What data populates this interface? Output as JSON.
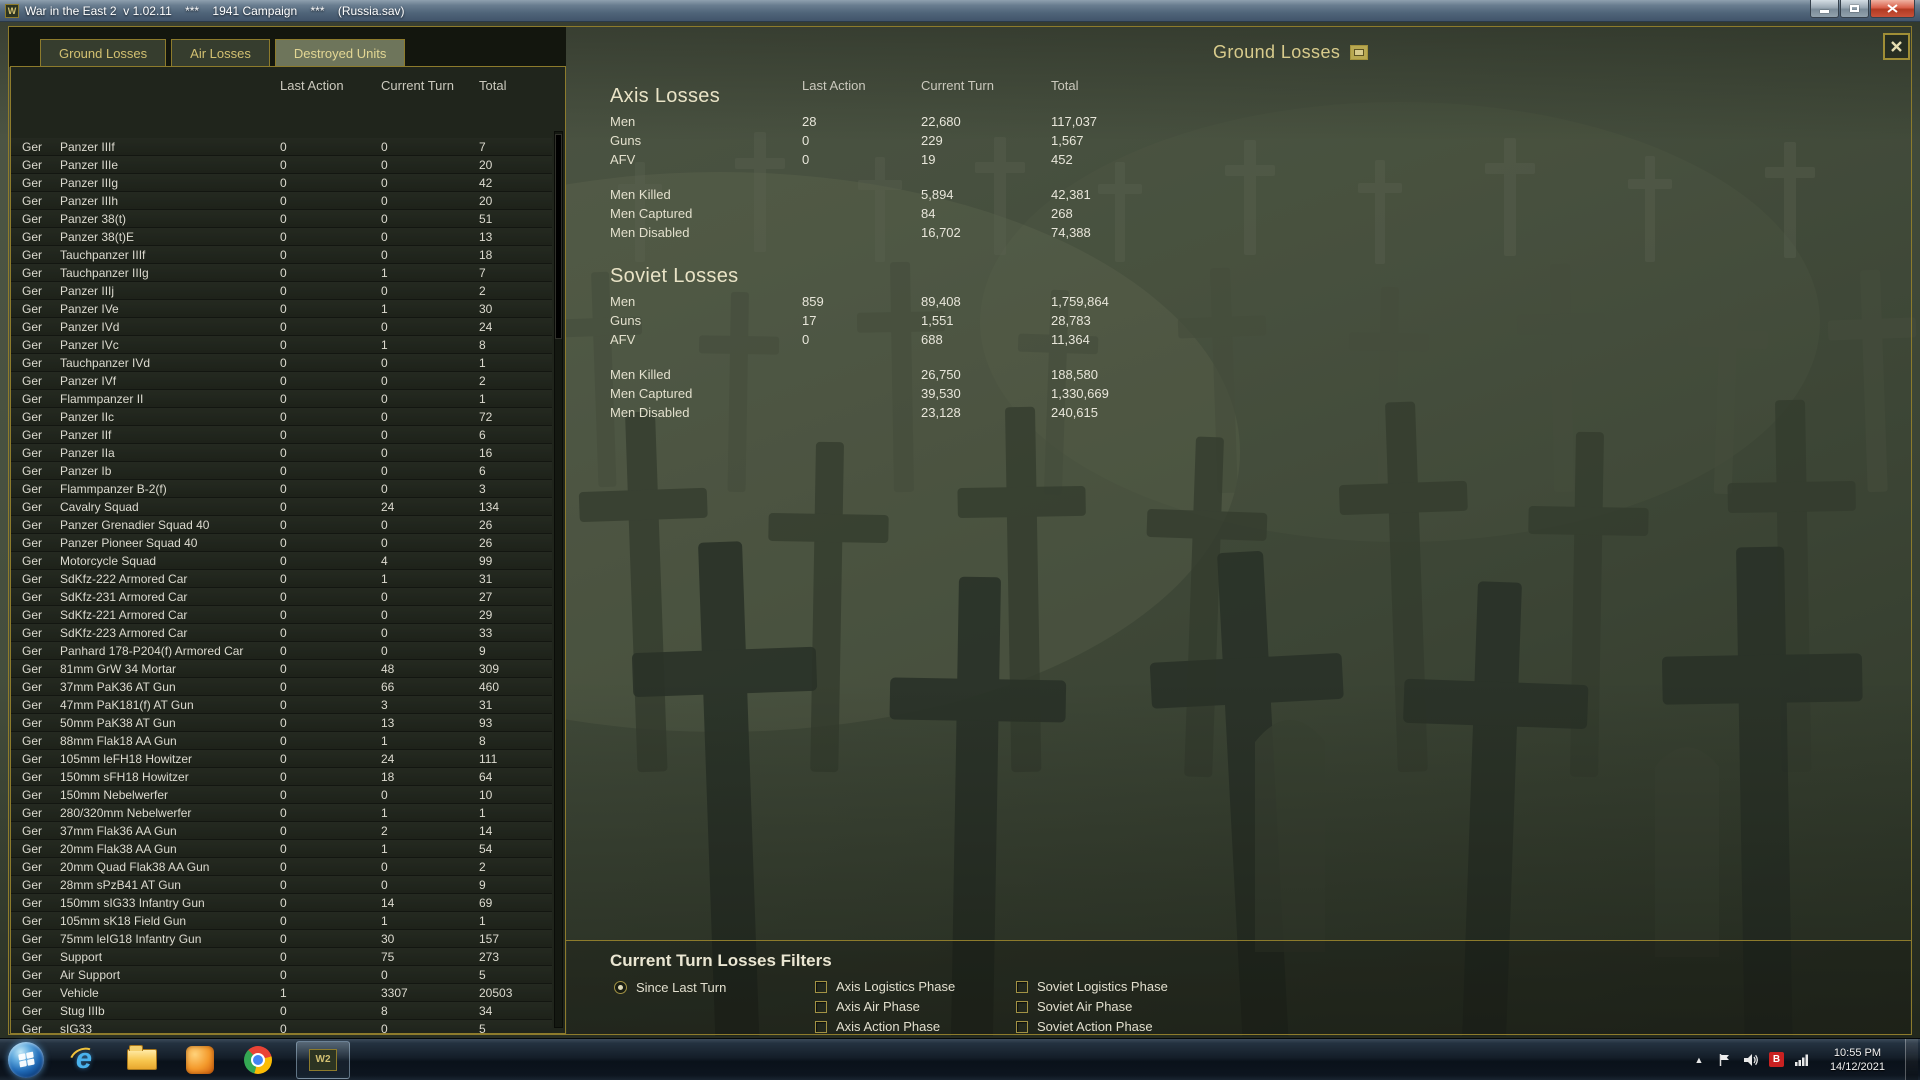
{
  "window": {
    "title": "War in the East 2  v 1.02.11    ***    1941 Campaign    ***    (Russia.sav)",
    "app_badge": "W"
  },
  "page_title": "Ground Losses",
  "tabs": [
    {
      "label": "Ground Losses",
      "active": false
    },
    {
      "label": "Air Losses",
      "active": false
    },
    {
      "label": "Destroyed Units",
      "active": true
    }
  ],
  "left_table": {
    "columns": [
      "Last Action",
      "Current Turn",
      "Total"
    ],
    "rows": [
      [
        "Ger",
        "Panzer IIIf",
        "0",
        "0",
        "7"
      ],
      [
        "Ger",
        "Panzer IIIe",
        "0",
        "0",
        "20"
      ],
      [
        "Ger",
        "Panzer IIIg",
        "0",
        "0",
        "42"
      ],
      [
        "Ger",
        "Panzer IIIh",
        "0",
        "0",
        "20"
      ],
      [
        "Ger",
        "Panzer 38(t)",
        "0",
        "0",
        "51"
      ],
      [
        "Ger",
        "Panzer 38(t)E",
        "0",
        "0",
        "13"
      ],
      [
        "Ger",
        "Tauchpanzer IIIf",
        "0",
        "0",
        "18"
      ],
      [
        "Ger",
        "Tauchpanzer IIIg",
        "0",
        "1",
        "7"
      ],
      [
        "Ger",
        "Panzer IIIj",
        "0",
        "0",
        "2"
      ],
      [
        "Ger",
        "Panzer IVe",
        "0",
        "1",
        "30"
      ],
      [
        "Ger",
        "Panzer IVd",
        "0",
        "0",
        "24"
      ],
      [
        "Ger",
        "Panzer IVc",
        "0",
        "1",
        "8"
      ],
      [
        "Ger",
        "Tauchpanzer IVd",
        "0",
        "0",
        "1"
      ],
      [
        "Ger",
        "Panzer IVf",
        "0",
        "0",
        "2"
      ],
      [
        "Ger",
        "Flammpanzer II",
        "0",
        "0",
        "1"
      ],
      [
        "Ger",
        "Panzer IIc",
        "0",
        "0",
        "72"
      ],
      [
        "Ger",
        "Panzer IIf",
        "0",
        "0",
        "6"
      ],
      [
        "Ger",
        "Panzer IIa",
        "0",
        "0",
        "16"
      ],
      [
        "Ger",
        "Panzer Ib",
        "0",
        "0",
        "6"
      ],
      [
        "Ger",
        "Flammpanzer B-2(f)",
        "0",
        "0",
        "3"
      ],
      [
        "Ger",
        "Cavalry Squad",
        "0",
        "24",
        "134"
      ],
      [
        "Ger",
        "Panzer Grenadier Squad 40",
        "0",
        "0",
        "26"
      ],
      [
        "Ger",
        "Panzer Pioneer Squad 40",
        "0",
        "0",
        "26"
      ],
      [
        "Ger",
        "Motorcycle Squad",
        "0",
        "4",
        "99"
      ],
      [
        "Ger",
        "SdKfz-222 Armored Car",
        "0",
        "1",
        "31"
      ],
      [
        "Ger",
        "SdKfz-231 Armored Car",
        "0",
        "0",
        "27"
      ],
      [
        "Ger",
        "SdKfz-221 Armored Car",
        "0",
        "0",
        "29"
      ],
      [
        "Ger",
        "SdKfz-223 Armored Car",
        "0",
        "0",
        "33"
      ],
      [
        "Ger",
        "Panhard 178-P204(f) Armored Car",
        "0",
        "0",
        "9"
      ],
      [
        "Ger",
        "81mm GrW 34 Mortar",
        "0",
        "48",
        "309"
      ],
      [
        "Ger",
        "37mm PaK36 AT Gun",
        "0",
        "66",
        "460"
      ],
      [
        "Ger",
        "47mm PaK181(f) AT Gun",
        "0",
        "3",
        "31"
      ],
      [
        "Ger",
        "50mm PaK38 AT Gun",
        "0",
        "13",
        "93"
      ],
      [
        "Ger",
        "88mm Flak18 AA Gun",
        "0",
        "1",
        "8"
      ],
      [
        "Ger",
        "105mm leFH18 Howitzer",
        "0",
        "24",
        "111"
      ],
      [
        "Ger",
        "150mm sFH18 Howitzer",
        "0",
        "18",
        "64"
      ],
      [
        "Ger",
        "150mm Nebelwerfer",
        "0",
        "0",
        "10"
      ],
      [
        "Ger",
        "280/320mm Nebelwerfer",
        "0",
        "1",
        "1"
      ],
      [
        "Ger",
        "37mm Flak36 AA Gun",
        "0",
        "2",
        "14"
      ],
      [
        "Ger",
        "20mm Flak38 AA Gun",
        "0",
        "1",
        "54"
      ],
      [
        "Ger",
        "20mm Quad Flak38 AA Gun",
        "0",
        "0",
        "2"
      ],
      [
        "Ger",
        "28mm sPzB41 AT Gun",
        "0",
        "0",
        "9"
      ],
      [
        "Ger",
        "150mm sIG33 Infantry Gun",
        "0",
        "14",
        "69"
      ],
      [
        "Ger",
        "105mm sK18 Field Gun",
        "0",
        "1",
        "1"
      ],
      [
        "Ger",
        "75mm leIG18 Infantry Gun",
        "0",
        "30",
        "157"
      ],
      [
        "Ger",
        "Support",
        "0",
        "75",
        "273"
      ],
      [
        "Ger",
        "Air Support",
        "0",
        "0",
        "5"
      ],
      [
        "Ger",
        "Vehicle",
        "1",
        "3307",
        "20503"
      ],
      [
        "Ger",
        "Stug IIIb",
        "0",
        "8",
        "34"
      ],
      [
        "Ger",
        "sIG33",
        "0",
        "0",
        "5"
      ]
    ]
  },
  "loss_columns": [
    "Last Action",
    "Current Turn",
    "Total"
  ],
  "axis": {
    "title": "Axis Losses",
    "rows": [
      [
        "Men",
        "28",
        "22,680",
        "117,037"
      ],
      [
        "Guns",
        "0",
        "229",
        "1,567"
      ],
      [
        "AFV",
        "0",
        "19",
        "452"
      ]
    ],
    "details": [
      [
        "Men Killed",
        "5,894",
        "42,381"
      ],
      [
        "Men Captured",
        "84",
        "268"
      ],
      [
        "Men Disabled",
        "16,702",
        "74,388"
      ]
    ]
  },
  "soviet": {
    "title": "Soviet Losses",
    "rows": [
      [
        "Men",
        "859",
        "89,408",
        "1,759,864"
      ],
      [
        "Guns",
        "17",
        "1,551",
        "28,783"
      ],
      [
        "AFV",
        "0",
        "688",
        "11,364"
      ]
    ],
    "details": [
      [
        "Men Killed",
        "26,750",
        "188,580"
      ],
      [
        "Men Captured",
        "39,530",
        "1,330,669"
      ],
      [
        "Men Disabled",
        "23,128",
        "240,615"
      ]
    ]
  },
  "filters": {
    "title": "Current Turn Losses Filters",
    "radio_label": "Since Last Turn",
    "radio_selected": true,
    "columns": [
      [
        "Axis Logistics Phase",
        "Axis Air Phase",
        "Axis Action Phase"
      ],
      [
        "Soviet Logistics Phase",
        "Soviet Air Phase",
        "Soviet Action Phase"
      ]
    ]
  },
  "taskbar": {
    "clock_time": "10:55 PM",
    "clock_date": "14/12/2021",
    "game_badge": "W2"
  },
  "icons": {
    "title_badge": "report-grid-icon",
    "dialog_close": "close-icon",
    "taskbar_apps": [
      "start-orb",
      "internet-explorer",
      "file-explorer",
      "media-app",
      "chrome",
      "war-in-the-east-2"
    ],
    "tray": [
      "hidden-icons-chevron",
      "action-center-flag",
      "volume",
      "app-badge-b",
      "network-bars"
    ]
  }
}
